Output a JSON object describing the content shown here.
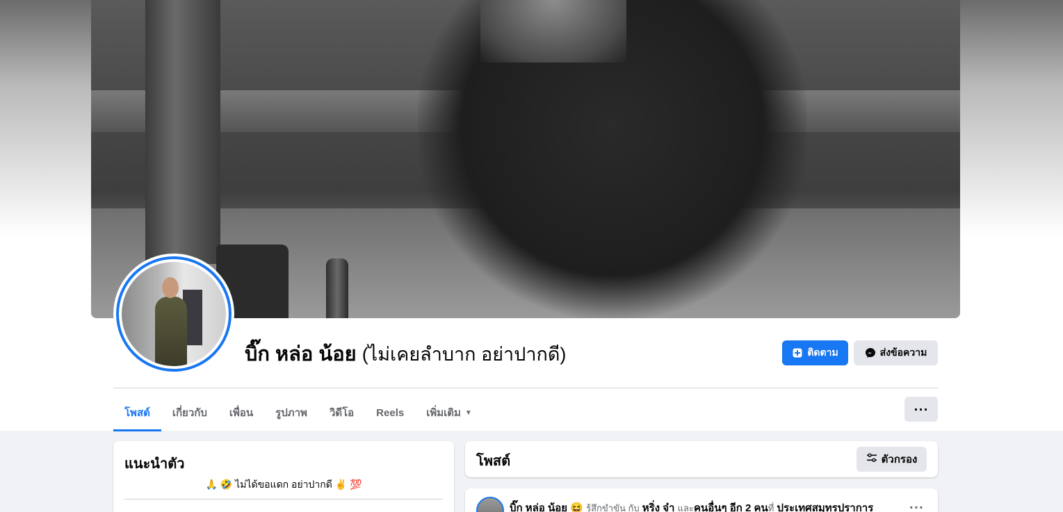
{
  "profile": {
    "name": "บิ๊ก หล่อ น้อย",
    "alternate_name": "(ไม่เคยลำบาก อย่าปากดี)",
    "follow_label": "ติดตาม",
    "message_label": "ส่งข้อความ"
  },
  "tabs": [
    {
      "label": "โพสต์",
      "active": true
    },
    {
      "label": "เกี่ยวกับ"
    },
    {
      "label": "เพื่อน"
    },
    {
      "label": "รูปภาพ"
    },
    {
      "label": "วิดีโอ"
    },
    {
      "label": "Reels"
    },
    {
      "label": "เพิ่มเติม"
    }
  ],
  "more_button_label": "···",
  "intro": {
    "title": "แนะนำตัว",
    "bio": "🙏 🤣 ไม่ได้ขอแดก อย่าปากดี ✌ 💯"
  },
  "posts": {
    "title": "โพสต์",
    "filter_label": "ตัวกรอง",
    "first_post": {
      "author": "บิ๊ก หล่อ น้อย",
      "feeling_emoji": "😆",
      "feeling": "รู้สึกขำขัน กับ",
      "tagged": "หริ่ง จ๋า",
      "and_text": "และ",
      "others": "คนอื่นๆ อีก 2 คน",
      "at_text": "ที่",
      "place": "ประเทศสมุทรปราการ",
      "more_label": "···"
    }
  },
  "colors": {
    "accent": "#1877f2",
    "button_gray": "#e4e6eb",
    "page_bg": "#f0f2f5"
  }
}
